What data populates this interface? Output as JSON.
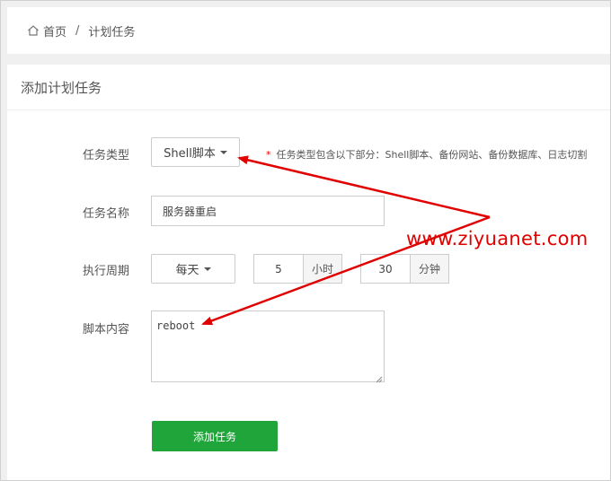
{
  "breadcrumb": {
    "home": "首页",
    "separator": "/",
    "current": "计划任务"
  },
  "panel": {
    "title": "添加计划任务"
  },
  "form": {
    "task_type": {
      "label": "任务类型",
      "value": "Shell脚本",
      "hint": "任务类型包含以下部分：Shell脚本、备份网站、备份数据库、日志切割",
      "hint_star": "*"
    },
    "task_name": {
      "label": "任务名称",
      "value": "服务器重启"
    },
    "cycle": {
      "label": "执行周期",
      "period": "每天",
      "hour_value": "5",
      "hour_unit": "小时",
      "minute_value": "30",
      "minute_unit": "分钟"
    },
    "script": {
      "label": "脚本内容",
      "value": "reboot"
    },
    "submit_label": "添加任务"
  },
  "watermark": "www.ziyuanet.com",
  "colors": {
    "accent_green": "#20a53a",
    "annotation_red": "#e00000"
  }
}
